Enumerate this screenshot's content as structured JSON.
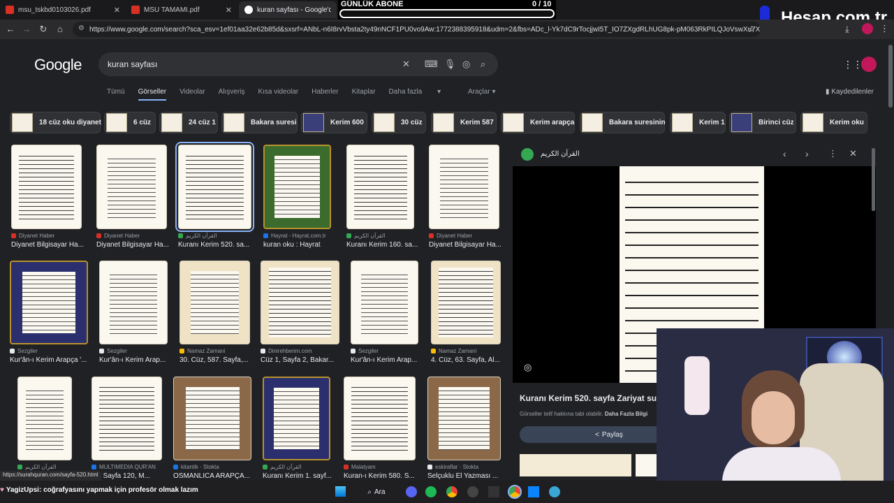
{
  "browser": {
    "tabs": [
      {
        "title": "msu_tskbd0103026.pdf",
        "active": false
      },
      {
        "title": "MSU TAMAMI.pdf",
        "active": false
      },
      {
        "title": "kuran sayfası - Google'da Ara",
        "active": true
      }
    ],
    "url": "https://www.google.com/search?sca_esv=1ef01aa32e62b85d&sxsrf=ANbL-n6I8rvVbsta2ty49nNCF1PU0vo9Aw:1772388395918&udm=2&fbs=ADc_l-Yk7dC9rTocjjwI5T_IO7ZXgdRLhUG8pk-pM063RkPILQJoVswXu7XoIdd5UEH6f..."
  },
  "overlay": {
    "goal_label": "GÜNLÜK ABONE",
    "goal_value": "0 / 10",
    "goal_progress": 0,
    "watermark": "Hesap.com.tr"
  },
  "google": {
    "logo": "Google",
    "query": "kuran sayfası",
    "tabs": [
      "Tümü",
      "Görseller",
      "Videolar",
      "Alışveriş",
      "Kısa videolar",
      "Haberler",
      "Kitaplar",
      "Daha fazla"
    ],
    "tools": "Araçlar",
    "saved": "Kaydedilenler",
    "chips": [
      "18 cüz oku diyanet",
      "6 cüz",
      "24 cüz 1",
      "Bakara suresi",
      "Kerim 600",
      "30 cüz",
      "Kerim 587",
      "Kerim arapça",
      "Bakara suresinin",
      "Kerim 1",
      "Birinci cüz",
      "Kerim oku"
    ],
    "results": [
      {
        "source": "Diyanet Haber",
        "title": "Diyanet Bilgisayar Ha..."
      },
      {
        "source": "Diyanet Haber",
        "title": "Diyanet Bilgisayar Ha..."
      },
      {
        "source": "القرآن الكريم",
        "title": "Kuranı Kerim 520. sa..."
      },
      {
        "source": "Hayrat - Hayrat.com.tr",
        "title": "kuran oku : Hayrat"
      },
      {
        "source": "القرآن الكريم",
        "title": "Kuranı Kerim 160. sa..."
      },
      {
        "source": "Diyanet Haber",
        "title": "Diyanet Bilgisayar Ha..."
      },
      {
        "source": "Sezgiler",
        "title": "Kur'ân-ı Kerim Arapça '..."
      },
      {
        "source": "Sezgiler",
        "title": "Kur'ân-ı Kerim Arap..."
      },
      {
        "source": "Namaz Zamani",
        "title": "30. Cüz, 587. Sayfa,..."
      },
      {
        "source": "Dinirehberim.com",
        "title": "Cüz 1, Sayfa 2, Bakar..."
      },
      {
        "source": "Sezgiler",
        "title": "Kur'ân-ı Kerim Arap..."
      },
      {
        "source": "Namaz Zamani",
        "title": "4. Cüz, 63. Sayfa, Al..."
      },
      {
        "source": "القرآن الكريم",
        "title": ""
      },
      {
        "source": "MULTIMEDIA QUR'AN",
        "title": "; 6, Sayfa 120, M..."
      },
      {
        "source": "kitantik · Stokta",
        "title": "OSMANLICA ARAPÇA..."
      },
      {
        "source": "القرآن الكريم",
        "title": "Kuranı Kerim 1. sayf..."
      },
      {
        "source": "Malatyam",
        "title": "Kuran-ı Kerim 580. S..."
      },
      {
        "source": "eskiraflar · Stokta",
        "title": "Selçuklu El Yazması ..."
      }
    ],
    "status_url": "https://surahquran.com/sayfa-520.html",
    "panel": {
      "site": "القرآن الكريم",
      "title": "Kuranı Kerim 520. sayfa Zariyat suresi",
      "notice": "Görseller telif hakkına tabi olabilir.",
      "more": "Daha Fazla Bilgi",
      "share": "Paylaş"
    }
  },
  "chat": {
    "user": "YagizUpsi",
    "message": ": coğrafyasını yapmak için profesör olmak lazım"
  },
  "taskbar": {
    "search": "Ara"
  }
}
